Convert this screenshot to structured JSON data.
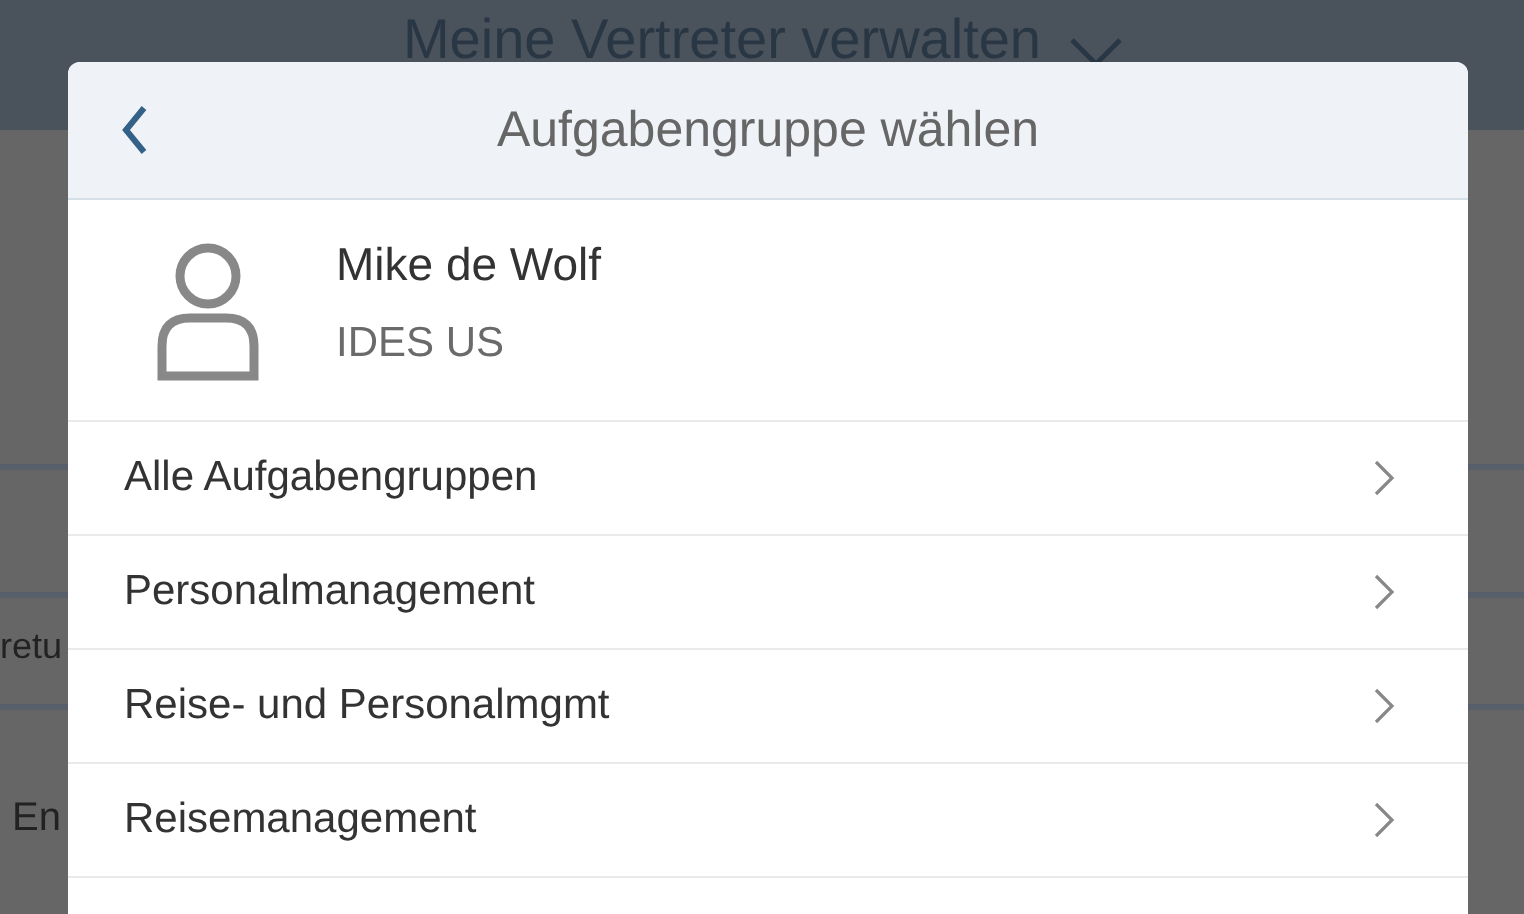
{
  "background": {
    "title": "Meine Vertreter verwalten",
    "fragments": [
      "retu",
      "En"
    ]
  },
  "dialog": {
    "title": "Aufgabengruppe wählen",
    "user": {
      "name": "Mike de Wolf",
      "company": "IDES US"
    },
    "items": [
      {
        "label": "Alle Aufgabengruppen"
      },
      {
        "label": "Personalmanagement"
      },
      {
        "label": "Reise- und Personalmgmt"
      },
      {
        "label": "Reisemanagement"
      }
    ]
  }
}
